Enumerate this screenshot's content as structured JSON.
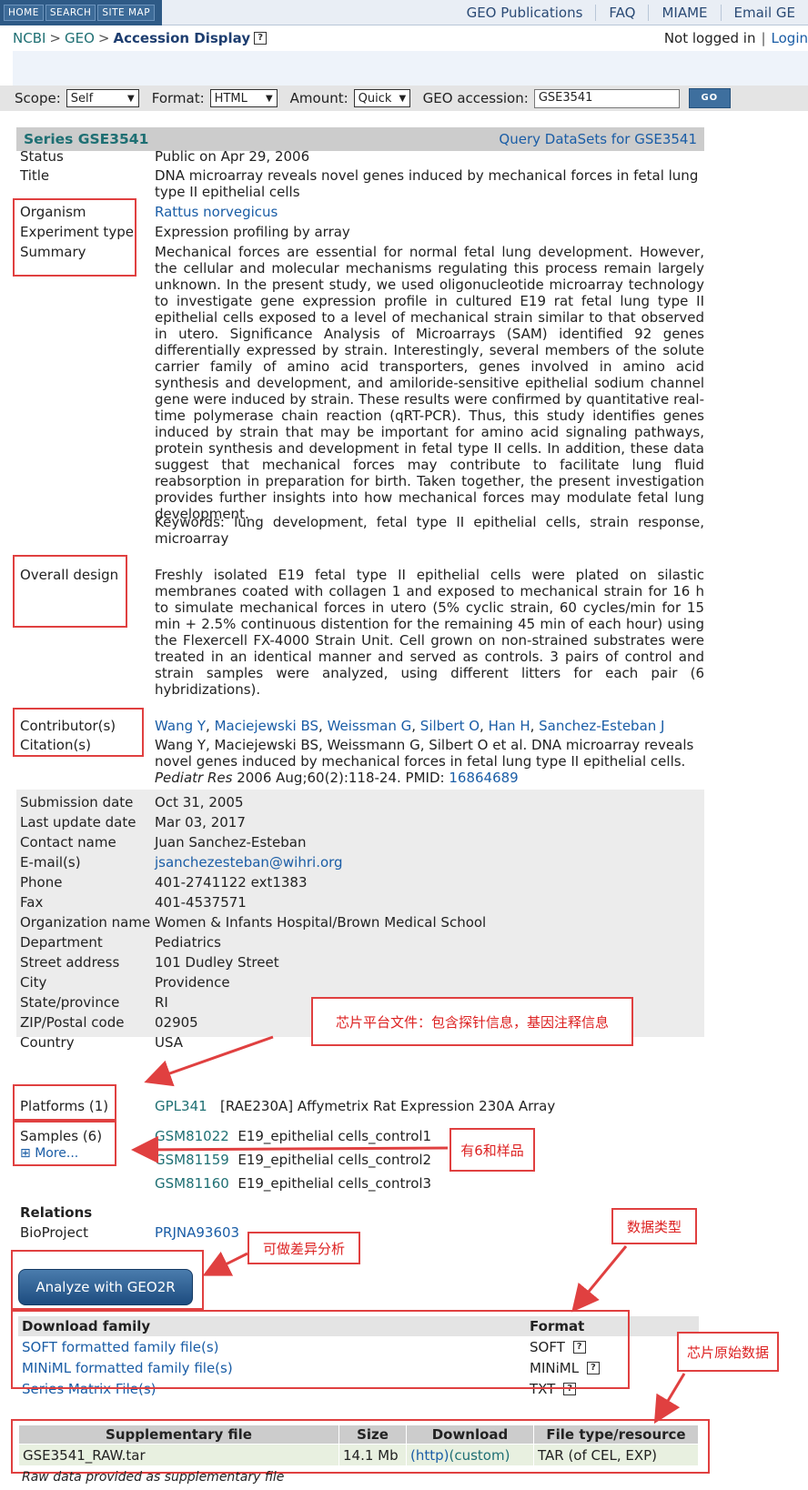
{
  "nav": {
    "home": "HOME",
    "search": "SEARCH",
    "sitemap": "SITE MAP",
    "links": [
      "GEO Publications",
      "FAQ",
      "MIAME",
      "Email GE"
    ]
  },
  "breadcrumb": {
    "ncbi": "NCBI",
    "geo": "GEO",
    "current": "Accession Display",
    "help": "?"
  },
  "login": {
    "status": "Not logged in",
    "sep": "|",
    "link": "Login"
  },
  "query": {
    "scope_label": "Scope:",
    "scope": "Self",
    "format_label": "Format:",
    "format": "HTML",
    "amount_label": "Amount:",
    "amount": "Quick",
    "acc_label": "GEO accession:",
    "acc": "GSE3541",
    "go": "GO"
  },
  "series": {
    "title": "Series GSE3541",
    "query_link": "Query DataSets for GSE3541"
  },
  "fields": {
    "status_label": "Status",
    "status": "Public on Apr 29, 2006",
    "title_label": "Title",
    "title": "DNA microarray reveals novel genes induced by mechanical forces in fetal lung type II epithelial cells",
    "organism_label": "Organism",
    "organism": "Rattus norvegicus",
    "exptype_label": "Experiment type",
    "exptype": "Expression profiling by array",
    "summary_label": "Summary",
    "summary": "Mechanical forces are essential for normal fetal lung development. However, the cellular and molecular mechanisms regulating this process remain largely unknown. In the present study, we used oligonucleotide microarray technology to investigate gene expression profile in cultured E19 rat fetal lung type II epithelial cells exposed to a level of mechanical strain similar to that observed in utero. Significance Analysis of Microarrays (SAM) identified 92 genes differentially expressed by strain. Interestingly, several members of the solute carrier family of amino acid transporters, genes involved in amino acid synthesis and development, and amiloride-sensitive epithelial sodium channel gene were induced by strain. These results were confirmed by quantitative real-time polymerase chain reaction (qRT-PCR). Thus, this study identifies genes induced by strain that may be important for amino acid signaling pathways, protein synthesis and development in fetal type II cells. In addition, these data suggest that mechanical forces may contribute to facilitate lung fluid reabsorption in preparation for birth. Taken together, the present investigation provides further insights into how mechanical forces may modulate fetal lung development.",
    "keywords": "Keywords: lung development, fetal type II epithelial cells, strain response, microarray",
    "design_label": "Overall design",
    "design": "Freshly isolated E19 fetal type II epithelial cells were plated on silastic membranes coated with collagen 1 and exposed to mechanical strain for 16 h to simulate mechanical forces in utero (5% cyclic strain, 60 cycles/min for 15 min + 2.5% continuous distention for the remaining 45 min of each hour) using the Flexercell FX-4000 Strain Unit. Cell grown on non-strained substrates were treated in an identical manner and served as controls. 3 pairs of control and strain samples were analyzed, using different litters for each pair (6 hybridizations).",
    "contrib_label": "Contributor(s)",
    "contributors": [
      "Wang Y",
      "Maciejewski BS",
      "Weissman G",
      "Silbert O",
      "Han H",
      "Sanchez-Esteban J"
    ],
    "citation_label": "Citation(s)",
    "citation_text": "Wang Y, Maciejewski BS, Weissmann G, Silbert O et al. DNA microarray reveals novel genes induced by mechanical forces in fetal lung type II epithelial cells.",
    "citation_journal": "Pediatr Res",
    "citation_tail": "2006 Aug;60(2):118-24. PMID:",
    "pmid": "16864689"
  },
  "contact": {
    "submission_label": "Submission date",
    "submission": "Oct 31, 2005",
    "update_label": "Last update date",
    "update": "Mar 03, 2017",
    "name_label": "Contact name",
    "name": "Juan Sanchez-Esteban",
    "email_label": "E-mail(s)",
    "email": "jsanchezesteban@wihri.org",
    "phone_label": "Phone",
    "phone": "401-2741122 ext1383",
    "fax_label": "Fax",
    "fax": "401-4537571",
    "org_label": "Organization name",
    "org": "Women & Infants Hospital/Brown Medical School",
    "dept_label": "Department",
    "dept": "Pediatrics",
    "street_label": "Street address",
    "street": "101 Dudley Street",
    "city_label": "City",
    "city": "Providence",
    "state_label": "State/province",
    "state": "RI",
    "zip_label": "ZIP/Postal code",
    "zip": "02905",
    "country_label": "Country",
    "country": "USA"
  },
  "platforms": {
    "label": "Platforms (1)",
    "id": "GPL341",
    "desc": "[RAE230A] Affymetrix Rat Expression 230A Array"
  },
  "samples": {
    "label": "Samples (6)",
    "more": "More...",
    "items": [
      {
        "id": "GSM81022",
        "desc": "E19_epithelial cells_control1"
      },
      {
        "id": "GSM81159",
        "desc": "E19_epithelial cells_control2"
      },
      {
        "id": "GSM81160",
        "desc": "E19_epithelial cells_control3"
      }
    ]
  },
  "relations": {
    "heading": "Relations",
    "bioproject_label": "BioProject",
    "bioproject": "PRJNA93603"
  },
  "geo2r": "Analyze with GEO2R",
  "download": {
    "col1": "Download family",
    "col2": "Format",
    "rows": [
      {
        "name": "SOFT formatted family file(s)",
        "format": "SOFT"
      },
      {
        "name": "MINiML formatted family file(s)",
        "format": "MINiML"
      },
      {
        "name": "Series Matrix File(s)",
        "format": "TXT"
      }
    ]
  },
  "supp": {
    "headers": [
      "Supplementary file",
      "Size",
      "Download",
      "File type/resource"
    ],
    "file": "GSE3541_RAW.tar",
    "size": "14.1 Mb",
    "http": "(http)",
    "custom": "(custom)",
    "type": "TAR (of CEL, EXP)",
    "footer": "Raw data provided as supplementary file"
  },
  "annotations": {
    "platform_note": "芯片平台文件：包含探针信息，基因注释信息",
    "samples_note": "有6和样品",
    "geo2r_note": "可做差异分析",
    "datatype_note": "数据类型",
    "raw_note": "芯片原始数据"
  },
  "colors": {
    "annotation_red": "#e04040",
    "link_blue": "#1a5da6",
    "geo_teal": "#1e6f73"
  }
}
